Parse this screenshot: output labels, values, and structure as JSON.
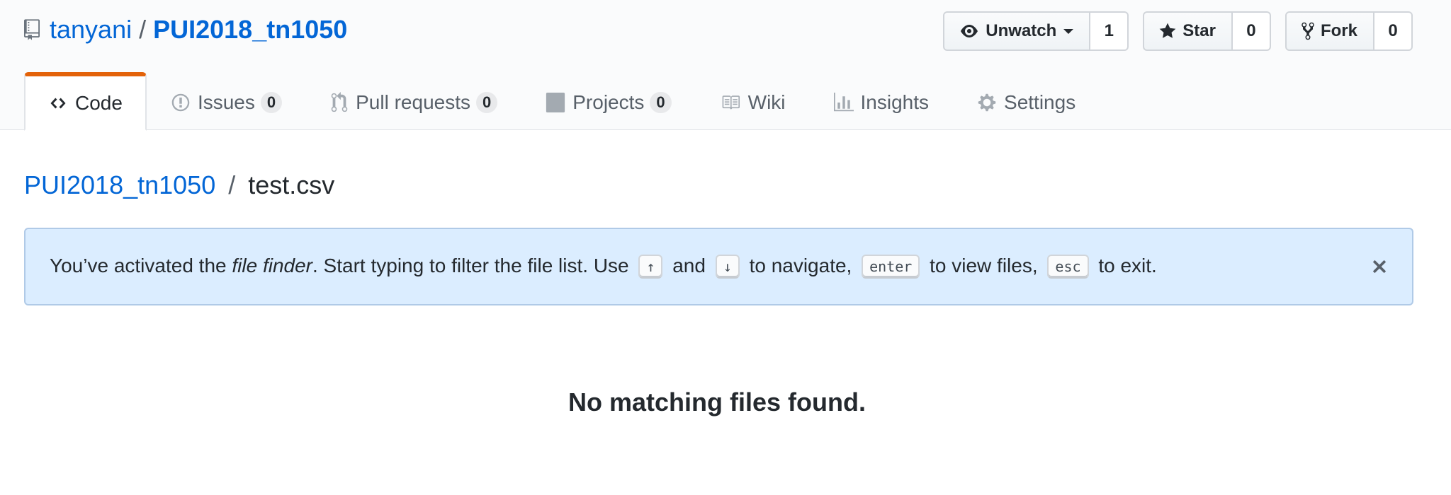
{
  "repo": {
    "owner": "tanyani",
    "separator": "/",
    "name": "PUI2018_tn1050"
  },
  "actions": {
    "watch": {
      "label": "Unwatch",
      "count": "1"
    },
    "star": {
      "label": "Star",
      "count": "0"
    },
    "fork": {
      "label": "Fork",
      "count": "0"
    }
  },
  "tabs": [
    {
      "label": "Code",
      "icon": "code-icon",
      "selected": true
    },
    {
      "label": "Issues",
      "count": "0",
      "icon": "issue-icon"
    },
    {
      "label": "Pull requests",
      "count": "0",
      "icon": "pull-request-icon"
    },
    {
      "label": "Projects",
      "count": "0",
      "icon": "project-icon"
    },
    {
      "label": "Wiki",
      "icon": "book-icon"
    },
    {
      "label": "Insights",
      "icon": "graph-icon"
    },
    {
      "label": "Settings",
      "icon": "gear-icon"
    }
  ],
  "breadcrumb": {
    "root": "PUI2018_tn1050",
    "separator": "/",
    "current": "test.csv"
  },
  "flash": {
    "part1": "You’ve activated the ",
    "emphasis": "file finder",
    "part2": ". Start typing to filter the file list. Use",
    "key_up": "↑",
    "and": "and",
    "key_down": "↓",
    "part3": "to navigate,",
    "key_enter": "enter",
    "part4": "to view files,",
    "key_esc": "esc",
    "part5": "to exit."
  },
  "empty_state": "No matching files found.",
  "colors": {
    "link": "#0366d6",
    "tab_accent": "#e36209",
    "flash_bg": "#dbedff"
  }
}
